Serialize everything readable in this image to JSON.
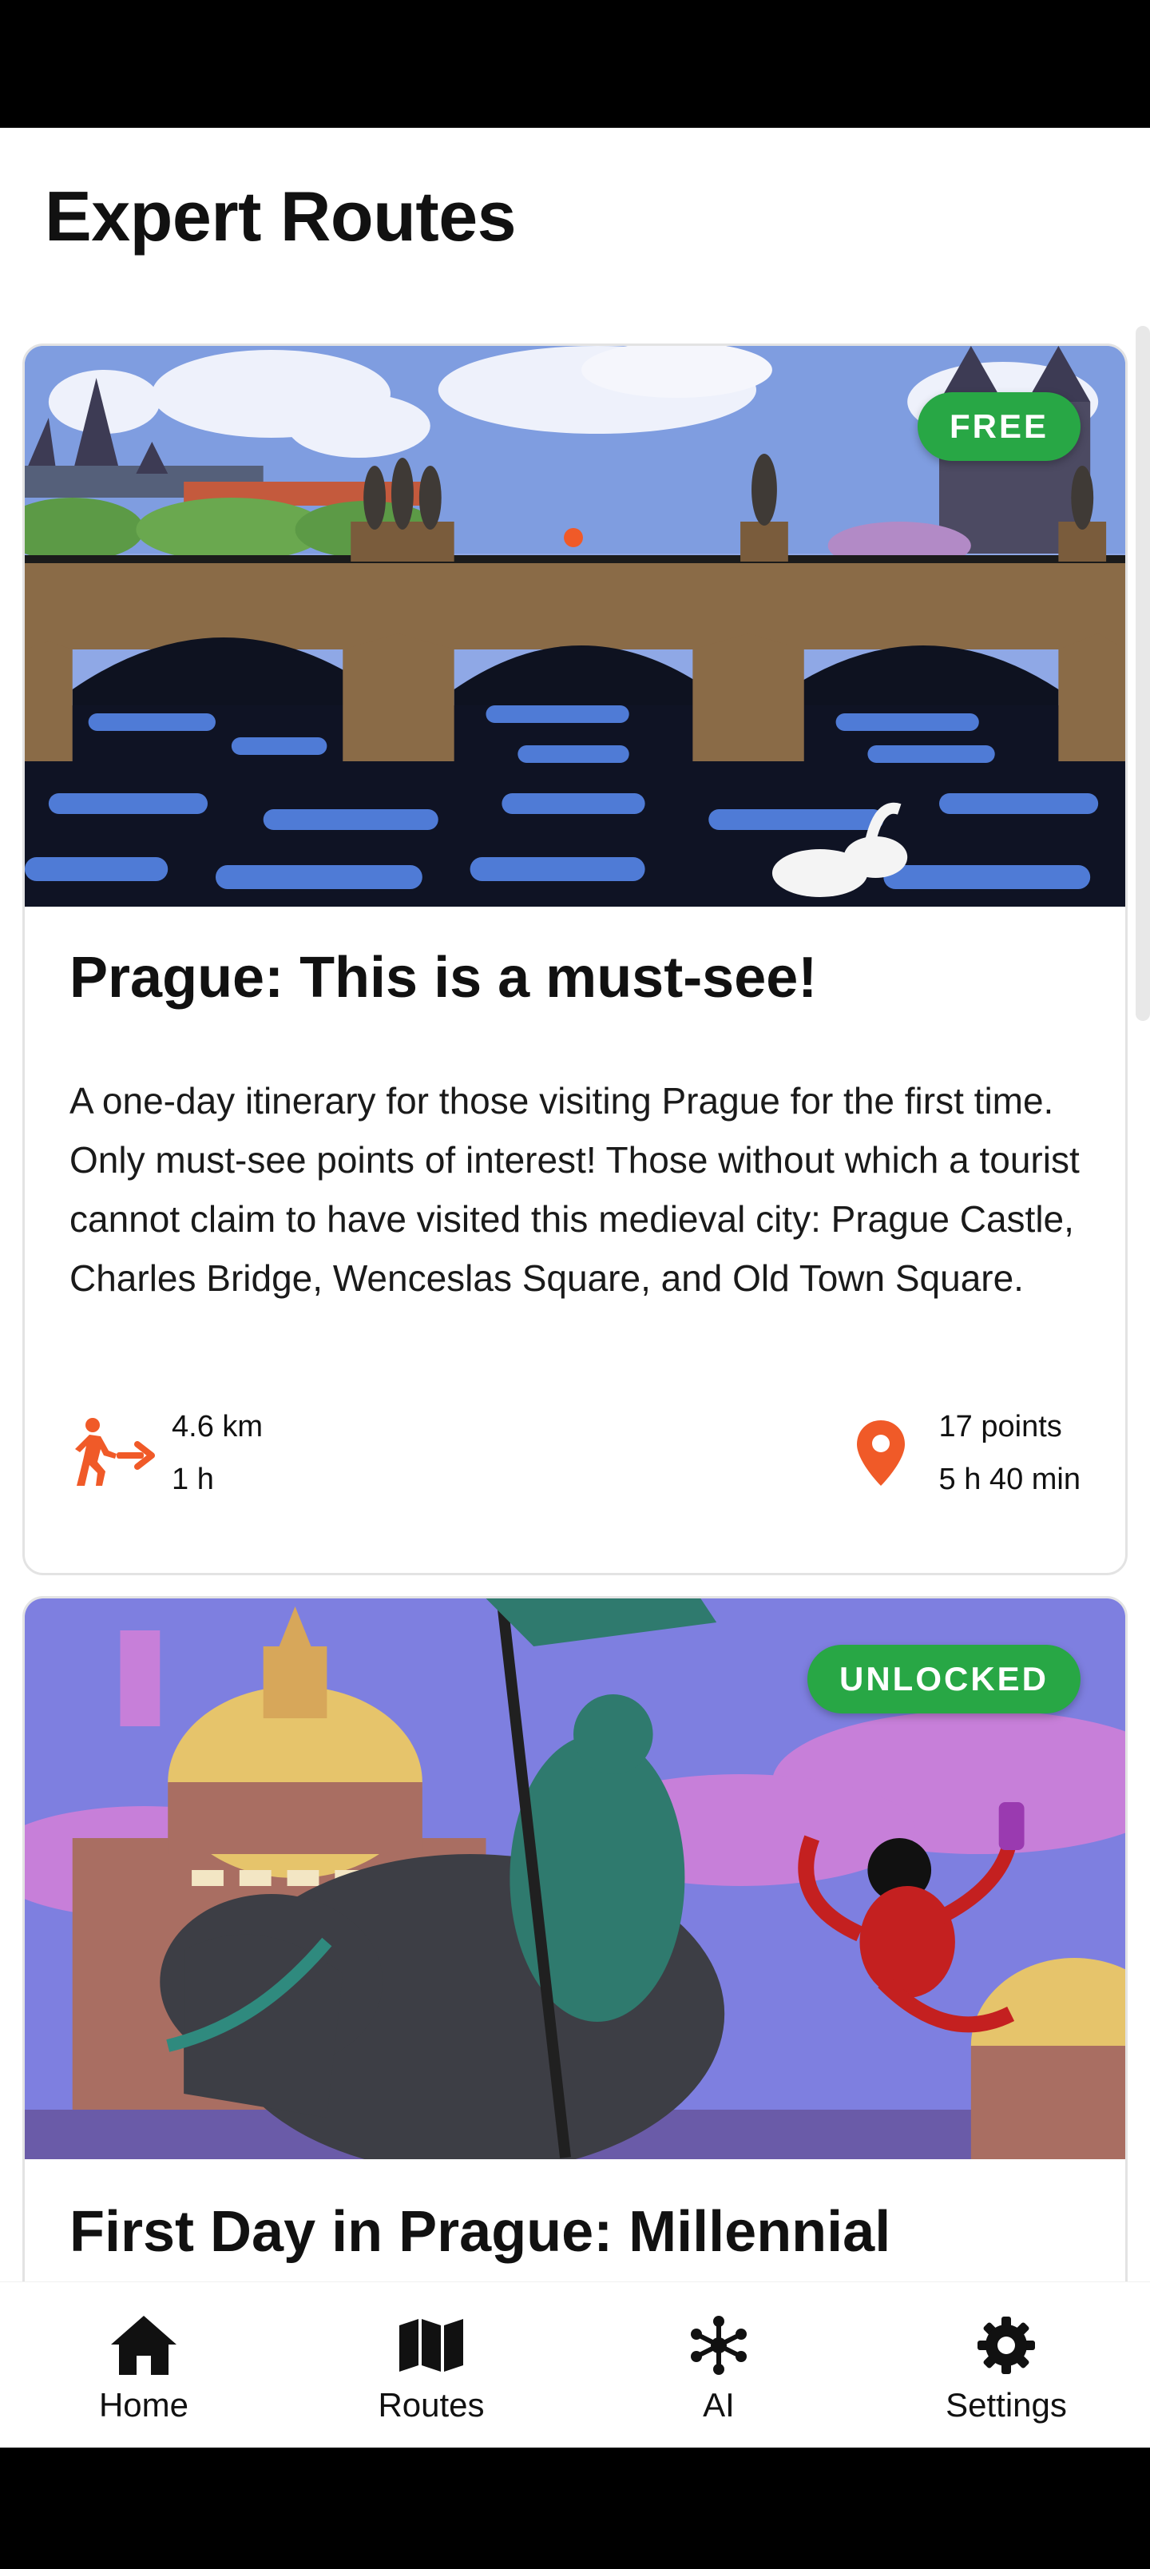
{
  "page": {
    "title": "Expert Routes"
  },
  "routes": [
    {
      "badge": "FREE",
      "title": "Prague: This is a must-see!",
      "description": "A one-day itinerary for those visiting Prague for the first time. Only must-see points of interest! Those without which a tourist cannot claim to have visited this medieval city: Prague Castle, Charles Bridge, Wenceslas Square, and Old Town Square.",
      "distance": "4.6 km",
      "walk_time": "1 h",
      "points": "17 points",
      "total_time": "5 h 40 min",
      "badge_color": "#28a745"
    },
    {
      "badge": "UNLOCKED",
      "title": "First Day in Prague: Millennial",
      "badge_color": "#28a745"
    }
  ],
  "icons": {
    "walk": "walking-distance-icon",
    "location": "location-pin-icon"
  },
  "colors": {
    "accent": "#f05a28",
    "badge_green": "#28a745"
  },
  "nav": {
    "items": [
      {
        "label": "Home",
        "icon": "home-icon"
      },
      {
        "label": "Routes",
        "icon": "map-icon"
      },
      {
        "label": "AI",
        "icon": "ai-network-icon"
      },
      {
        "label": "Settings",
        "icon": "gear-icon"
      }
    ]
  }
}
